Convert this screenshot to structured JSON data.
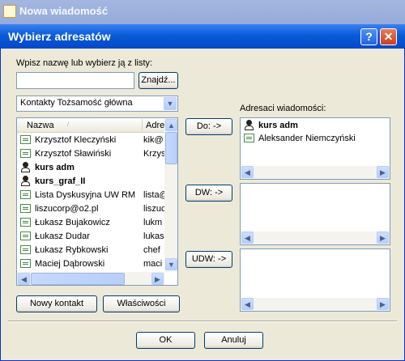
{
  "parent_window": {
    "title": "Nowa wiadomość"
  },
  "dialog": {
    "title": "Wybierz adresatów",
    "help_label": "?",
    "close_label": "✕",
    "search_label": "Wpisz nazwę lub wybierz ją z listy:",
    "search_value": "",
    "find_button": "Znajdź...",
    "address_book": "Kontakty Tożsamość główna",
    "columns": {
      "name": "Nazwa",
      "address": "Adre"
    },
    "contacts": [
      {
        "name": "Krzysztof Kleczyński",
        "address": "kik@",
        "type": "card",
        "bold": false
      },
      {
        "name": "Krzysztof Sławiński",
        "address": "Krzys",
        "type": "card",
        "bold": false
      },
      {
        "name": "kurs adm",
        "address": "",
        "type": "group",
        "bold": true
      },
      {
        "name": "kurs_graf_II",
        "address": "",
        "type": "group",
        "bold": true
      },
      {
        "name": "Lista Dyskusyjna UW RM",
        "address": "lista@",
        "type": "card",
        "bold": false
      },
      {
        "name": "liszucorp@o2.pl",
        "address": "liszuc",
        "type": "card",
        "bold": false
      },
      {
        "name": "Łukasz Bujakowicz",
        "address": "lukm",
        "type": "card",
        "bold": false
      },
      {
        "name": "Łukasz Dudar",
        "address": "lukas",
        "type": "card",
        "bold": false
      },
      {
        "name": "Łukasz Rybkowski",
        "address": "chef",
        "type": "card",
        "bold": false
      },
      {
        "name": "Maciej Dąbrowski",
        "address": "maci",
        "type": "card",
        "bold": false
      }
    ],
    "new_contact_button": "Nowy kontakt",
    "properties_button": "Właściwości",
    "recipients_label": "Adresaci wiadomości:",
    "to_button": "Do: ->",
    "cc_button": "DW: ->",
    "bcc_button": "UDW: ->",
    "to_recipients": [
      {
        "name": "kurs adm",
        "type": "group",
        "bold": true
      },
      {
        "name": "Aleksander Niemczyński",
        "type": "card",
        "bold": false
      }
    ],
    "ok_button": "OK",
    "cancel_button": "Anuluj"
  }
}
